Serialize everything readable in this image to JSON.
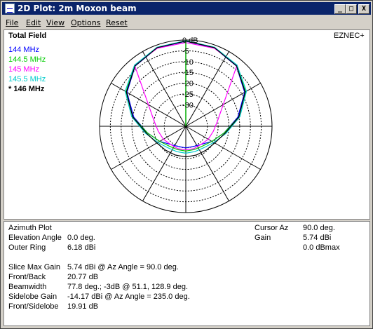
{
  "window": {
    "title": "2D Plot: 2m Moxon beam",
    "min_label": "_",
    "max_label": "□",
    "close_label": "X"
  },
  "menu": [
    {
      "label": "File"
    },
    {
      "label": "Edit"
    },
    {
      "label": "View"
    },
    {
      "label": "Options"
    },
    {
      "label": "Reset"
    }
  ],
  "plot": {
    "title": "Total Field",
    "brand": "EZNEC+",
    "legend": [
      {
        "label": "144 MHz",
        "color": "#0000ff"
      },
      {
        "label": "144.5 MHz",
        "color": "#00cc00"
      },
      {
        "label": "145 MHz",
        "color": "#ff00ff"
      },
      {
        "label": "145.5 MHz",
        "color": "#00cccc"
      },
      {
        "label": "* 146 MHz",
        "color": "#000000"
      }
    ]
  },
  "chart_data": {
    "type": "polar",
    "title": "Total Field",
    "ring_labels": [
      "0 dB",
      "-5",
      "-10",
      "-15",
      "-20",
      "-25",
      "-30"
    ],
    "ring_values_db": [
      0,
      -5,
      -10,
      -15,
      -20,
      -25,
      -30
    ],
    "outer_ring_dbi": 6.18,
    "spoke_angles_deg": [
      0,
      30,
      60,
      90,
      120,
      150,
      180,
      210,
      240,
      270,
      300,
      330
    ],
    "series": [
      {
        "name": "144 MHz",
        "color": "#0000ff",
        "angles_deg": [
          0,
          20,
          40,
          60,
          80,
          100,
          120,
          140,
          160,
          180,
          200,
          220,
          240,
          260,
          280,
          300,
          320,
          340
        ],
        "db": [
          -0.6,
          -1.3,
          -3.5,
          -8.5,
          -15.5,
          -22,
          -26,
          -29,
          -30,
          -30,
          -30,
          -29,
          -26,
          -22,
          -15.5,
          -8.5,
          -3.5,
          -1.3
        ]
      },
      {
        "name": "144.5 MHz",
        "color": "#00cc00",
        "angles_deg": [
          0,
          20,
          40,
          60,
          80,
          100,
          120,
          140,
          160,
          180,
          200,
          220,
          240,
          260,
          280,
          300,
          320,
          340
        ],
        "db": [
          -0.4,
          -1.1,
          -3.2,
          -8,
          -15,
          -22,
          -26,
          -28,
          -28.5,
          -28.5,
          -28.5,
          -28,
          -26,
          -22,
          -15,
          -8,
          -3.2,
          -1.1
        ]
      },
      {
        "name": "145 MHz",
        "color": "#ff00ff",
        "angles_deg": [
          0,
          20,
          40,
          60,
          80,
          100,
          120,
          140,
          160,
          180,
          200,
          220,
          240,
          260,
          280,
          300,
          320,
          340
        ],
        "db": [
          -1.2,
          -1.5,
          -3.0,
          -20,
          -25,
          -27,
          -28,
          -29,
          -29,
          -29,
          -29,
          -29,
          -28,
          -27,
          -25,
          -20,
          -3.0,
          -1.5
        ]
      },
      {
        "name": "145.5 MHz",
        "color": "#00cccc",
        "angles_deg": [
          0,
          20,
          40,
          60,
          80,
          100,
          120,
          140,
          160,
          180,
          200,
          220,
          240,
          260,
          280,
          300,
          320,
          340
        ],
        "db": [
          -0.3,
          -1.0,
          -3.0,
          -7.5,
          -14.5,
          -21,
          -25,
          -27,
          -27.5,
          -27.5,
          -27.5,
          -27,
          -25,
          -21,
          -14.5,
          -7.5,
          -3.0,
          -1.0
        ]
      },
      {
        "name": "146 MHz",
        "color": "#000000",
        "angles_deg": [
          0,
          20,
          40,
          60,
          80,
          100,
          120,
          140,
          160,
          180,
          200,
          220,
          240,
          260,
          280,
          300,
          320,
          340
        ],
        "db": [
          -0.5,
          -1.2,
          -3.4,
          -8.2,
          -15,
          -21.5,
          -24.5,
          -25.5,
          -25.8,
          -25.8,
          -25.8,
          -25.5,
          -24.5,
          -21.5,
          -15,
          -8.2,
          -3.4,
          -1.2
        ]
      }
    ]
  },
  "info": {
    "left": [
      {
        "label": "Azimuth Plot",
        "value": ""
      },
      {
        "label": "Elevation Angle",
        "value": "0.0 deg."
      },
      {
        "label": "Outer Ring",
        "value": "6.18 dBi"
      }
    ],
    "stats": [
      {
        "label": "Slice Max Gain",
        "value": "5.74 dBi @ Az Angle = 90.0 deg."
      },
      {
        "label": "Front/Back",
        "value": "20.77 dB"
      },
      {
        "label": "Beamwidth",
        "value": "77.8 deg.; -3dB @ 51.1, 128.9 deg."
      },
      {
        "label": "Sidelobe Gain",
        "value": "-14.17 dBi @ Az Angle = 235.0 deg."
      },
      {
        "label": "Front/Sidelobe",
        "value": "19.91 dB"
      }
    ],
    "right": [
      {
        "label": "Cursor Az",
        "value": "90.0 deg."
      },
      {
        "label": "Gain",
        "value": "5.74 dBi"
      },
      {
        "label": "",
        "value": "0.0 dBmax"
      }
    ]
  }
}
